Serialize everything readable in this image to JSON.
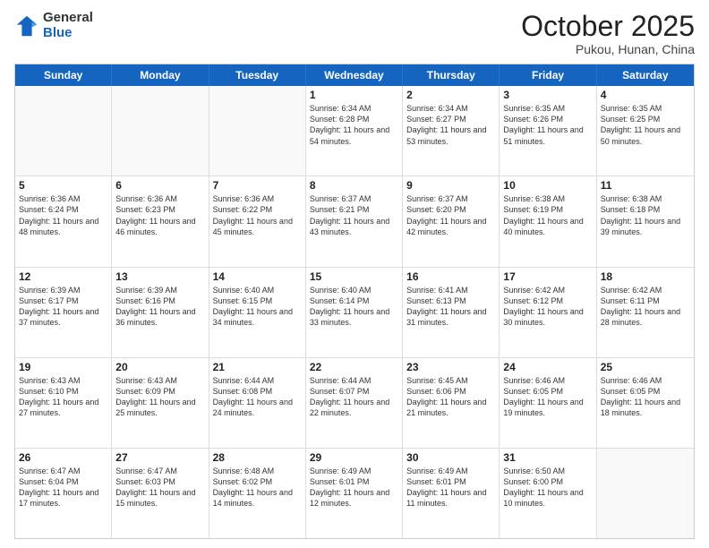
{
  "logo": {
    "general": "General",
    "blue": "Blue"
  },
  "header": {
    "month": "October 2025",
    "location": "Pukou, Hunan, China"
  },
  "weekdays": [
    "Sunday",
    "Monday",
    "Tuesday",
    "Wednesday",
    "Thursday",
    "Friday",
    "Saturday"
  ],
  "rows": [
    [
      {
        "day": "",
        "info": ""
      },
      {
        "day": "",
        "info": ""
      },
      {
        "day": "",
        "info": ""
      },
      {
        "day": "1",
        "info": "Sunrise: 6:34 AM\nSunset: 6:28 PM\nDaylight: 11 hours\nand 54 minutes."
      },
      {
        "day": "2",
        "info": "Sunrise: 6:34 AM\nSunset: 6:27 PM\nDaylight: 11 hours\nand 53 minutes."
      },
      {
        "day": "3",
        "info": "Sunrise: 6:35 AM\nSunset: 6:26 PM\nDaylight: 11 hours\nand 51 minutes."
      },
      {
        "day": "4",
        "info": "Sunrise: 6:35 AM\nSunset: 6:25 PM\nDaylight: 11 hours\nand 50 minutes."
      }
    ],
    [
      {
        "day": "5",
        "info": "Sunrise: 6:36 AM\nSunset: 6:24 PM\nDaylight: 11 hours\nand 48 minutes."
      },
      {
        "day": "6",
        "info": "Sunrise: 6:36 AM\nSunset: 6:23 PM\nDaylight: 11 hours\nand 46 minutes."
      },
      {
        "day": "7",
        "info": "Sunrise: 6:36 AM\nSunset: 6:22 PM\nDaylight: 11 hours\nand 45 minutes."
      },
      {
        "day": "8",
        "info": "Sunrise: 6:37 AM\nSunset: 6:21 PM\nDaylight: 11 hours\nand 43 minutes."
      },
      {
        "day": "9",
        "info": "Sunrise: 6:37 AM\nSunset: 6:20 PM\nDaylight: 11 hours\nand 42 minutes."
      },
      {
        "day": "10",
        "info": "Sunrise: 6:38 AM\nSunset: 6:19 PM\nDaylight: 11 hours\nand 40 minutes."
      },
      {
        "day": "11",
        "info": "Sunrise: 6:38 AM\nSunset: 6:18 PM\nDaylight: 11 hours\nand 39 minutes."
      }
    ],
    [
      {
        "day": "12",
        "info": "Sunrise: 6:39 AM\nSunset: 6:17 PM\nDaylight: 11 hours\nand 37 minutes."
      },
      {
        "day": "13",
        "info": "Sunrise: 6:39 AM\nSunset: 6:16 PM\nDaylight: 11 hours\nand 36 minutes."
      },
      {
        "day": "14",
        "info": "Sunrise: 6:40 AM\nSunset: 6:15 PM\nDaylight: 11 hours\nand 34 minutes."
      },
      {
        "day": "15",
        "info": "Sunrise: 6:40 AM\nSunset: 6:14 PM\nDaylight: 11 hours\nand 33 minutes."
      },
      {
        "day": "16",
        "info": "Sunrise: 6:41 AM\nSunset: 6:13 PM\nDaylight: 11 hours\nand 31 minutes."
      },
      {
        "day": "17",
        "info": "Sunrise: 6:42 AM\nSunset: 6:12 PM\nDaylight: 11 hours\nand 30 minutes."
      },
      {
        "day": "18",
        "info": "Sunrise: 6:42 AM\nSunset: 6:11 PM\nDaylight: 11 hours\nand 28 minutes."
      }
    ],
    [
      {
        "day": "19",
        "info": "Sunrise: 6:43 AM\nSunset: 6:10 PM\nDaylight: 11 hours\nand 27 minutes."
      },
      {
        "day": "20",
        "info": "Sunrise: 6:43 AM\nSunset: 6:09 PM\nDaylight: 11 hours\nand 25 minutes."
      },
      {
        "day": "21",
        "info": "Sunrise: 6:44 AM\nSunset: 6:08 PM\nDaylight: 11 hours\nand 24 minutes."
      },
      {
        "day": "22",
        "info": "Sunrise: 6:44 AM\nSunset: 6:07 PM\nDaylight: 11 hours\nand 22 minutes."
      },
      {
        "day": "23",
        "info": "Sunrise: 6:45 AM\nSunset: 6:06 PM\nDaylight: 11 hours\nand 21 minutes."
      },
      {
        "day": "24",
        "info": "Sunrise: 6:46 AM\nSunset: 6:05 PM\nDaylight: 11 hours\nand 19 minutes."
      },
      {
        "day": "25",
        "info": "Sunrise: 6:46 AM\nSunset: 6:05 PM\nDaylight: 11 hours\nand 18 minutes."
      }
    ],
    [
      {
        "day": "26",
        "info": "Sunrise: 6:47 AM\nSunset: 6:04 PM\nDaylight: 11 hours\nand 17 minutes."
      },
      {
        "day": "27",
        "info": "Sunrise: 6:47 AM\nSunset: 6:03 PM\nDaylight: 11 hours\nand 15 minutes."
      },
      {
        "day": "28",
        "info": "Sunrise: 6:48 AM\nSunset: 6:02 PM\nDaylight: 11 hours\nand 14 minutes."
      },
      {
        "day": "29",
        "info": "Sunrise: 6:49 AM\nSunset: 6:01 PM\nDaylight: 11 hours\nand 12 minutes."
      },
      {
        "day": "30",
        "info": "Sunrise: 6:49 AM\nSunset: 6:01 PM\nDaylight: 11 hours\nand 11 minutes."
      },
      {
        "day": "31",
        "info": "Sunrise: 6:50 AM\nSunset: 6:00 PM\nDaylight: 11 hours\nand 10 minutes."
      },
      {
        "day": "",
        "info": ""
      }
    ]
  ]
}
